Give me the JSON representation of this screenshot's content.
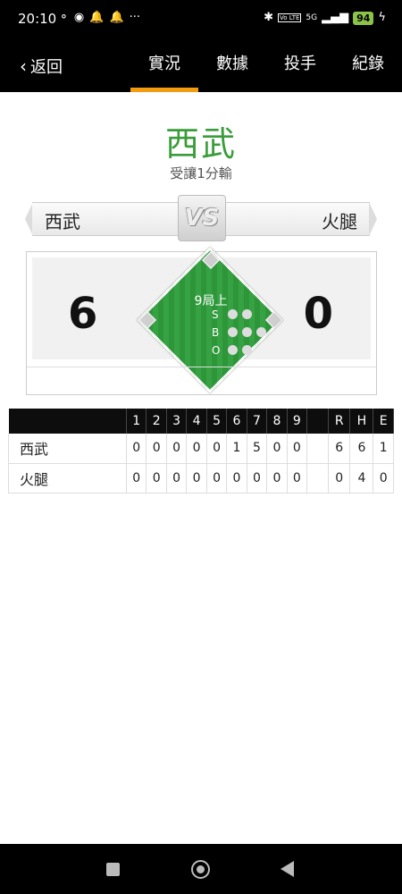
{
  "status": {
    "time": "20:10",
    "signal": "5G",
    "volte": "Vo LTE",
    "battery": "94"
  },
  "nav": {
    "back_label": "返回",
    "tabs": [
      {
        "label": "實況",
        "active": true
      },
      {
        "label": "數據",
        "active": false
      },
      {
        "label": "投手",
        "active": false
      },
      {
        "label": "紀錄",
        "active": false
      }
    ]
  },
  "game": {
    "winner": "西武",
    "result_text": "受讓1分輸",
    "vs": "VS",
    "team_left": "西武",
    "team_right": "火腿",
    "score_left": "6",
    "score_right": "0",
    "inning": "9局上",
    "count_labels": [
      "S",
      "B",
      "O"
    ]
  },
  "linescore": {
    "headers": [
      "1",
      "2",
      "3",
      "4",
      "5",
      "6",
      "7",
      "8",
      "9",
      "R",
      "H",
      "E"
    ],
    "rows": [
      {
        "team": "西武",
        "innings": [
          "0",
          "0",
          "0",
          "0",
          "0",
          "1",
          "5",
          "0",
          "0"
        ],
        "R": "6",
        "H": "6",
        "E": "1"
      },
      {
        "team": "火腿",
        "innings": [
          "0",
          "0",
          "0",
          "0",
          "0",
          "0",
          "0",
          "0",
          "0"
        ],
        "R": "0",
        "H": "4",
        "E": "0"
      }
    ]
  },
  "colors": {
    "accent": "#f39c12",
    "winner_green": "#3a9c3a",
    "field_green": "#2f9e3c"
  }
}
